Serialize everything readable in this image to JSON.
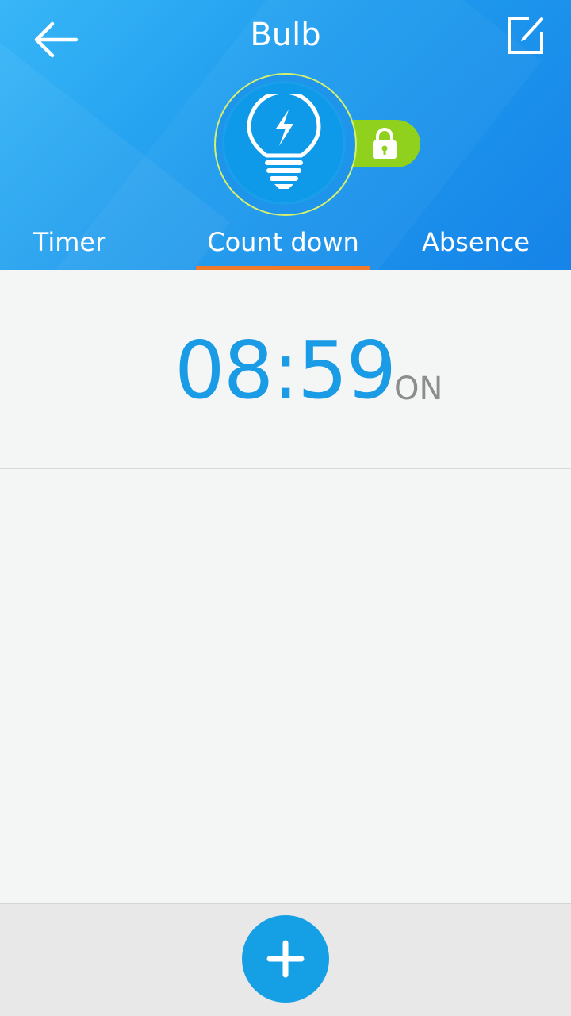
{
  "header": {
    "title": "Bulb",
    "back_icon": "arrow-left-icon",
    "edit_icon": "edit-icon",
    "device_icon": "lightbulb-bolt-icon",
    "lock_icon": "lock-icon",
    "colors": {
      "gradient_start": "#38b6f7",
      "gradient_end": "#1683e8",
      "lock_pill": "#8fd11c",
      "tab_underline": "#f07a2a"
    }
  },
  "tabs": [
    {
      "label": "Timer",
      "active": false
    },
    {
      "label": "Count down",
      "active": true
    },
    {
      "label": "Absence",
      "active": false
    }
  ],
  "countdown": {
    "time": "08:59",
    "state": "ON",
    "time_color": "#1a9be6"
  },
  "footer": {
    "add_icon": "plus-icon",
    "add_color": "#15a0e6"
  }
}
